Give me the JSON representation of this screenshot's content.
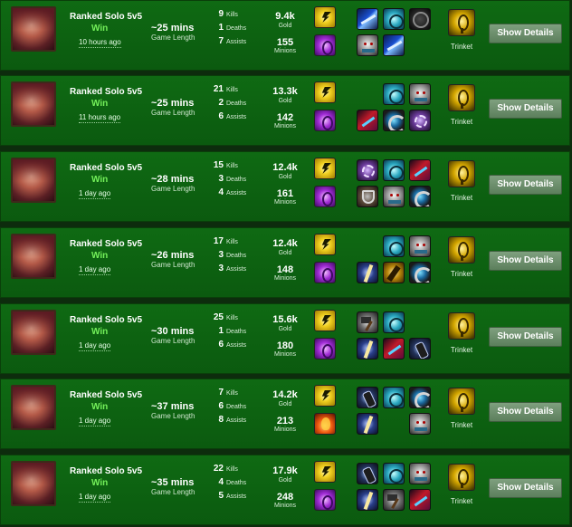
{
  "labels": {
    "kills": "Kills",
    "deaths": "Deaths",
    "assists": "Assists",
    "gold": "Gold",
    "minions": "Minions",
    "game_length": "Game Length",
    "trinket": "Trinket",
    "show_details": "Show Details"
  },
  "matches": [
    {
      "queue": "Ranked Solo 5v5",
      "result": "Win",
      "time_ago": "10 hours ago",
      "duration": "~25 mins",
      "kills": "9",
      "deaths": "1",
      "assists": "7",
      "gold": "9.4k",
      "minions": "155",
      "spells": [
        "flash-icon",
        "purple-spell-icon"
      ],
      "items": [
        "blade-item-icon",
        "frost-item-icon",
        "ring-item-icon",
        "skull-item-icon",
        "sword-blue-item-icon",
        "empty"
      ]
    },
    {
      "queue": "Ranked Solo 5v5",
      "result": "Win",
      "time_ago": "11 hours ago",
      "duration": "~25 mins",
      "kills": "21",
      "deaths": "2",
      "assists": "6",
      "gold": "13.3k",
      "minions": "142",
      "spells": [
        "flash-icon",
        "purple-spell-icon"
      ],
      "items": [
        "empty",
        "frost-item-icon",
        "skull-item-icon",
        "red-item-icon",
        "swirl-item-icon",
        "purple-item-icon"
      ]
    },
    {
      "queue": "Ranked Solo 5v5",
      "result": "Win",
      "time_ago": "1 day ago",
      "duration": "~28 mins",
      "kills": "15",
      "deaths": "3",
      "assists": "4",
      "gold": "12.4k",
      "minions": "161",
      "spells": [
        "flash-icon",
        "purple-spell-icon"
      ],
      "items": [
        "purple-item-icon",
        "frost-item-icon",
        "red-item-icon",
        "shield-item-icon",
        "skull-item-icon",
        "swirl-item-icon"
      ]
    },
    {
      "queue": "Ranked Solo 5v5",
      "result": "Win",
      "time_ago": "1 day ago",
      "duration": "~26 mins",
      "kills": "17",
      "deaths": "3",
      "assists": "3",
      "gold": "12.4k",
      "minions": "148",
      "spells": [
        "flash-icon",
        "purple-spell-icon"
      ],
      "items": [
        "empty",
        "frost-item-icon",
        "skull-item-icon",
        "sword-item-icon",
        "gold-item-icon",
        "swirl-item-icon"
      ]
    },
    {
      "queue": "Ranked Solo 5v5",
      "result": "Win",
      "time_ago": "1 day ago",
      "duration": "~30 mins",
      "kills": "25",
      "deaths": "1",
      "assists": "6",
      "gold": "15.6k",
      "minions": "180",
      "spells": [
        "flash-icon",
        "purple-spell-icon"
      ],
      "items": [
        "hammer-item-icon",
        "frost-item-icon",
        "empty",
        "sword-item-icon",
        "red-item-icon",
        "gauntlet-item-icon"
      ]
    },
    {
      "queue": "Ranked Solo 5v5",
      "result": "Win",
      "time_ago": "1 day ago",
      "duration": "~37 mins",
      "kills": "7",
      "deaths": "6",
      "assists": "8",
      "gold": "14.2k",
      "minions": "213",
      "spells": [
        "flash-icon",
        "ignite-icon"
      ],
      "items": [
        "gauntlet-item-icon",
        "frost-item-icon",
        "swirl-item-icon",
        "sword-item-icon",
        "empty",
        "skull-item-icon"
      ]
    },
    {
      "queue": "Ranked Solo 5v5",
      "result": "Win",
      "time_ago": "1 day ago",
      "duration": "~35 mins",
      "kills": "22",
      "deaths": "4",
      "assists": "5",
      "gold": "17.9k",
      "minions": "248",
      "spells": [
        "flash-icon",
        "purple-spell-icon"
      ],
      "items": [
        "gauntlet-item-icon",
        "frost-item-icon",
        "skull-item-icon",
        "sword-item-icon",
        "hammer-item-icon",
        "red-item-icon"
      ]
    }
  ]
}
